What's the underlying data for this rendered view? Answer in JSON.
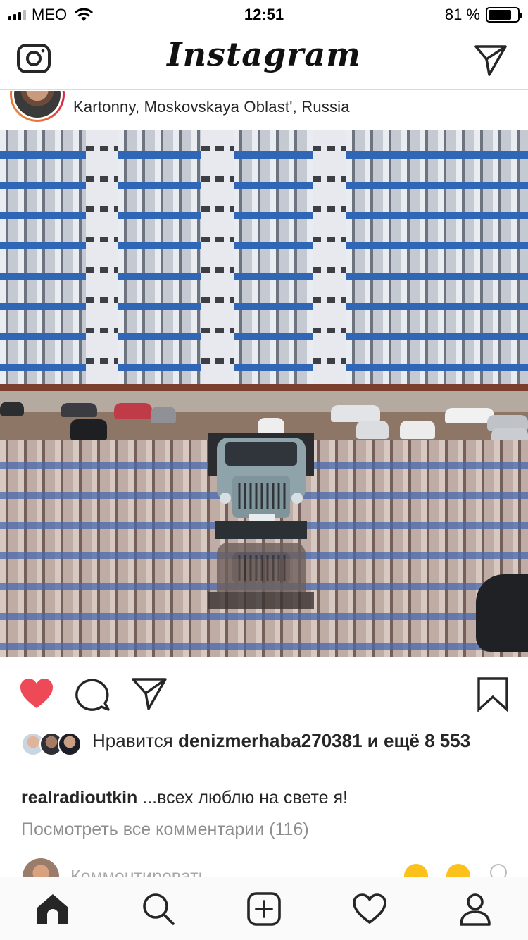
{
  "status_bar": {
    "carrier": "MEO",
    "time": "12:51",
    "battery": "81 %",
    "battery_level": 0.81
  },
  "header": {
    "logo": "Instagram"
  },
  "post": {
    "location": "Kartonny, Moskovskaya Oblast', Russia",
    "liked": true,
    "likes_prefix": "Нравится",
    "liked_by": "denizmerhaba270381",
    "likes_middle": "и",
    "likes_more": "ещё 8 553",
    "caption_user": "realradioutkin",
    "caption_text": "...всех люблю на свете я!",
    "view_comments": "Посмотреть все комментарии (116)",
    "comment_placeholder": "Комментировать"
  },
  "colors": {
    "like_red": "#ed4956",
    "text": "#262626",
    "muted": "#8e8e8e"
  },
  "icons": [
    "camera-icon",
    "direct-icon",
    "more-icon",
    "heart-icon",
    "comment-icon",
    "share-icon",
    "bookmark-icon",
    "home-icon",
    "search-icon",
    "add-icon",
    "activity-icon",
    "profile-icon"
  ]
}
